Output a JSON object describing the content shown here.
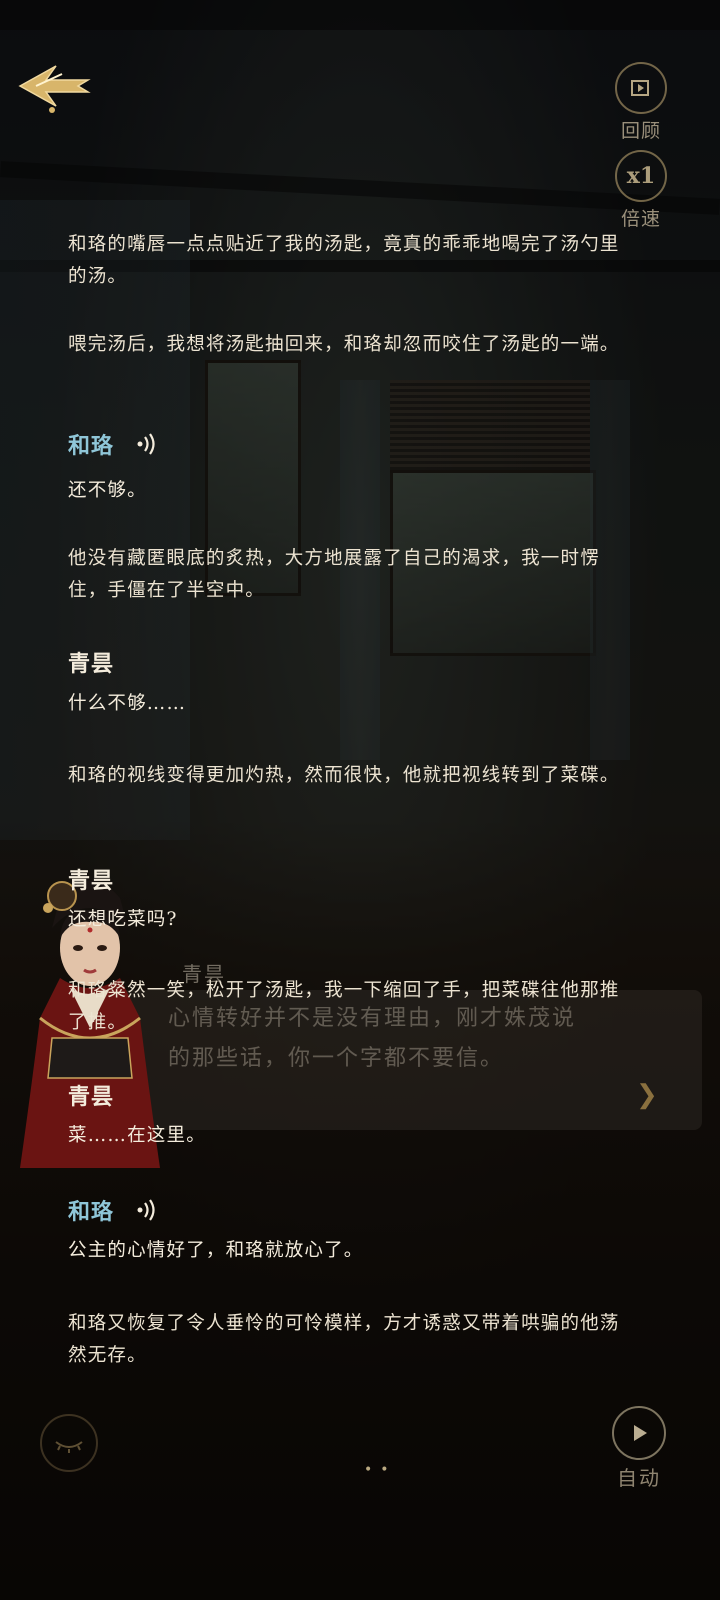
{
  "controls": {
    "review_label": "回顾",
    "speed_value": "x1",
    "speed_label": "倍速",
    "auto_label": "自动"
  },
  "background_dialog": {
    "speaker": "青昙",
    "line1": "心情转好并不是没有理由，刚才姝茂说",
    "line2": "的那些话，你一个字都不要信。"
  },
  "log": {
    "n1": "和珞的嘴唇一点点贴近了我的汤匙，竟真的乖乖地喝完了汤勺里的汤。",
    "n2": "喂完汤后，我想将汤匙抽回来，和珞却忽而咬住了汤匙的一端。",
    "s1_name": "和珞",
    "s1_line": "还不够。",
    "n3": "他没有藏匿眼底的炙热，大方地展露了自己的渴求，我一时愣住，手僵在了半空中。",
    "s2_name": "青昙",
    "s2_line": "什么不够……",
    "n4": "和珞的视线变得更加灼热，然而很快，他就把视线转到了菜碟。",
    "s3_name": "青昙",
    "s3_line": "还想吃菜吗?",
    "n5": "和珞粲然一笑，松开了汤匙，我一下缩回了手，把菜碟往他那推了推。",
    "s4_name": "青昙",
    "s4_line": "菜……在这里。",
    "s5_name": "和珞",
    "s5_line": "公主的心情好了，和珞就放心了。",
    "n6": "和珞又恢复了令人垂怜的可怜模样，方才诱惑又带着哄骗的他荡然无存。"
  },
  "colors": {
    "male_speaker": "#8fc6d8",
    "female_speaker": "#f4ecdc",
    "text": "#ece3d1",
    "gold_accent": "#d8b56a"
  },
  "icons": {
    "back": "ornate-back-arrow-icon",
    "review": "film-play-icon",
    "voice": "speaker-wave-icon",
    "hide_ui": "closed-eye-icon",
    "auto": "play-circle-icon"
  }
}
